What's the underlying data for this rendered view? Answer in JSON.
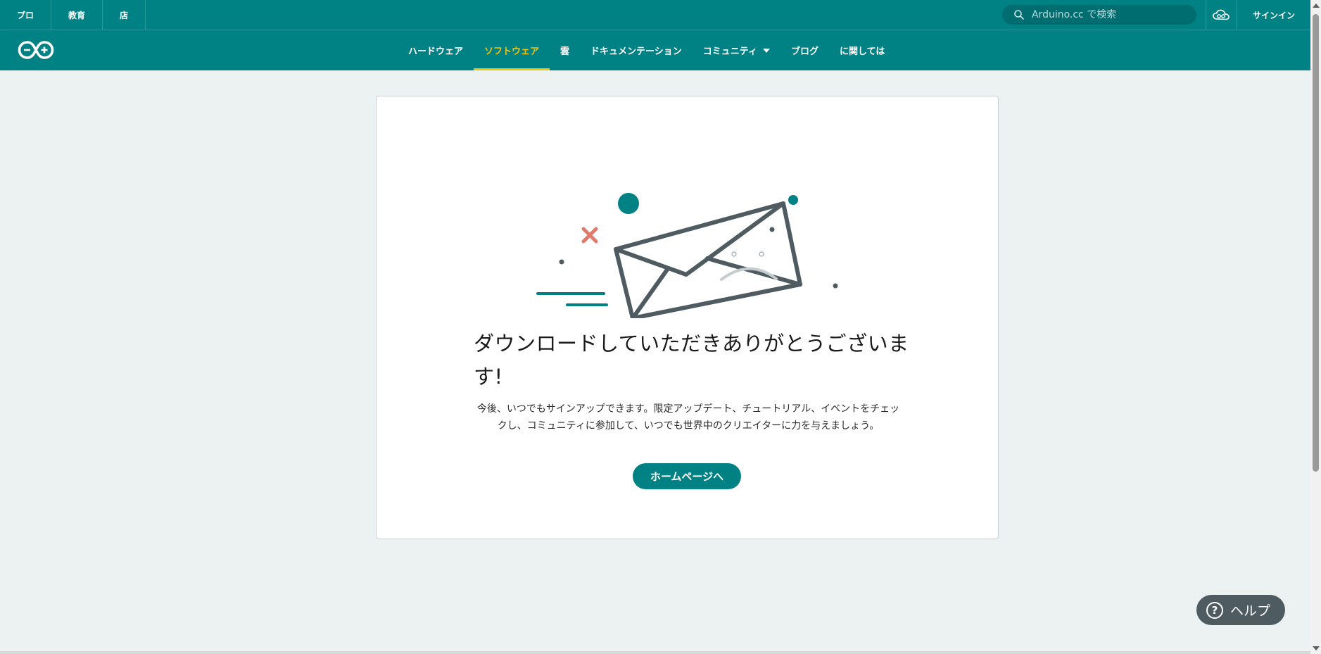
{
  "topbar": {
    "links": [
      "プロ",
      "教育",
      "店"
    ],
    "search_placeholder": "Arduino.cc で検索",
    "signin_label": "サインイン"
  },
  "nav": {
    "items": [
      {
        "label": "ハードウェア"
      },
      {
        "label": "ソフトウェア",
        "active": true
      },
      {
        "label": "雲"
      },
      {
        "label": "ドキュメンテーション"
      },
      {
        "label": "コミュニティ"
      },
      {
        "label": "ブログ"
      },
      {
        "label": "に関しては"
      }
    ]
  },
  "card": {
    "headline": "ダウンロードしていただきありがとうございます!",
    "subtext": "今後、いつでもサインアップできます。限定アップデート、チュートリアル、イベントをチェックし、コミュニティに参加して、いつでも世界中のクリエイターに力を与えましょう。",
    "button_label": "ホームページへ"
  },
  "help": {
    "label": "ヘルプ",
    "icon_glyph": "?"
  },
  "colors": {
    "brand_teal": "#008184",
    "active_yellow": "#f1c40f",
    "accent_red": "#e07b6c",
    "envelope_gray": "#4e5b61"
  },
  "icons": [
    "search-icon",
    "cloud-icon",
    "arduino-logo-icon",
    "chevron-down-icon",
    "envelope-icon",
    "help-icon"
  ]
}
